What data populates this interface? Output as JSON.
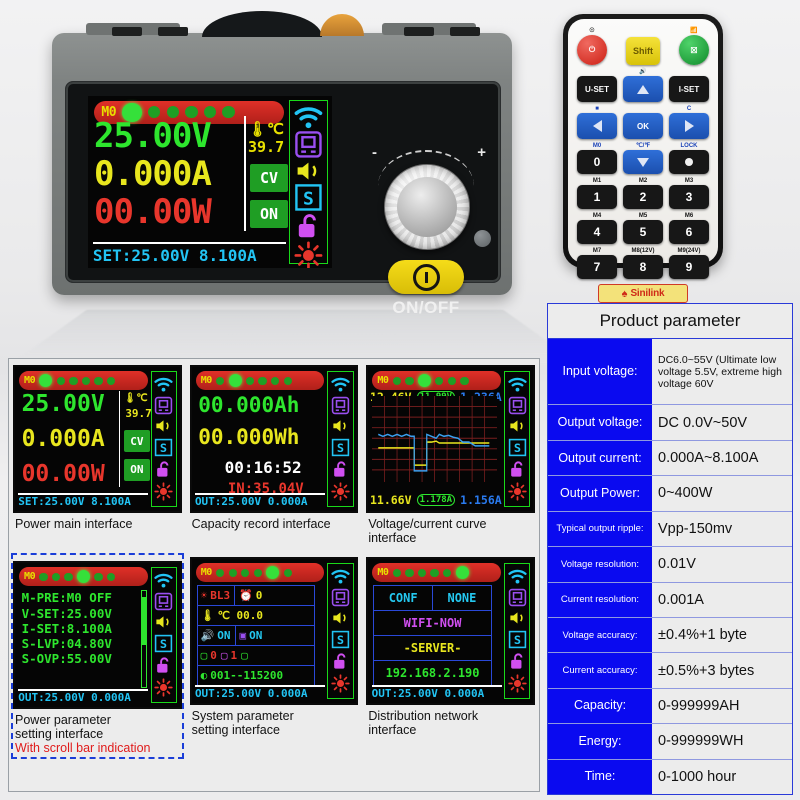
{
  "device": {
    "screen": {
      "memory_label": "M0",
      "voltage": "25.00V",
      "current": "0.000A",
      "power": "00.00W",
      "temp_unit": "℃",
      "temp_value": "39.7",
      "mode_badge": "CV",
      "output_badge": "ON",
      "setbar": "SET:25.00V 8.100A"
    },
    "controls": {
      "knob_minus": "-",
      "knob_plus": "+",
      "onoff_label": "ON/OFF"
    }
  },
  "remote": {
    "keys": {
      "power": "",
      "shift": "Shift",
      "wifi": "",
      "uset": "U-SET",
      "iset": "I-SET",
      "up": "",
      "ok": "OK",
      "left": "",
      "right": "",
      "down": "",
      "zero": "0",
      "one": "1",
      "two": "2",
      "three": "3",
      "four": "4",
      "five": "5",
      "six": "6",
      "seven": "7",
      "eight": "8",
      "nine": "9"
    },
    "captions": {
      "power_icon": "power-icon",
      "wifi_icon": "wifi-icon",
      "sound": "",
      "bright": "",
      "celsius": "C",
      "m0": "M0",
      "temp_mode": "℃/℉",
      "lock": "LOCK",
      "m1": "M1",
      "m2": "M2",
      "m3": "M3",
      "m4": "M4",
      "m5": "M5",
      "m6": "M6",
      "m7": "M7",
      "m8": "M8(12V)",
      "m9": "M9(24V)"
    },
    "brand": "Sinilink"
  },
  "screenshots": [
    {
      "id": "power-main",
      "caption": "Power main interface",
      "caption_note": "",
      "memory_label": "M0",
      "active_dot": 0,
      "voltage": "25.00V",
      "current": "0.000A",
      "power": "00.00W",
      "temp_unit": "℃",
      "temp_value": "39.7",
      "mode_badge": "CV",
      "output_badge": "ON",
      "setbar": "SET:25.00V 8.100A"
    },
    {
      "id": "capacity-record",
      "caption": "Capacity record interface",
      "caption_note": "",
      "memory_label": "M0",
      "active_dot": 1,
      "amp_hours": "00.000Ah",
      "watt_hours": "00.000Wh",
      "timer": "00:16:52",
      "input_label": "IN:35.04V",
      "setbar": "OUT:25.00V 0.000A"
    },
    {
      "id": "voltage-current-curve",
      "caption": "Voltage/current curve interface",
      "caption_note": "",
      "memory_label": "M0",
      "active_dot": 3,
      "top_voltage": "12.46V",
      "top_boxed": "11.99V",
      "top_current": "1.236A",
      "bottom_voltage": "11.66V",
      "bottom_boxed": "1.178A",
      "bottom_current": "1.156A"
    },
    {
      "id": "power-parameter-setting",
      "caption": "Power parameter\nsetting interface",
      "caption_note": "With scroll bar indication",
      "memory_label": "M0",
      "active_dot": 4,
      "rows": [
        "M-PRE:M0 OFF",
        "V-SET:25.00V",
        "I-SET:8.100A",
        "S-LVP:04.80V",
        "S-OVP:55.00V"
      ],
      "setbar": "OUT:25.00V 0.000A"
    },
    {
      "id": "system-parameter-setting",
      "caption": "System parameter\nsetting interface",
      "caption_note": "",
      "memory_label": "M0",
      "active_dot": 5,
      "backlight": "BL3",
      "timer_value": "0",
      "temperature": "℃ 00.0",
      "sound_state": "ON",
      "device_state": "ON",
      "mem_a": "0",
      "mem_b": "1",
      "comm": "001--115200",
      "setbar": "OUT:25.00V 0.000A"
    },
    {
      "id": "distribution-network",
      "caption": "Distribution network\ninterface",
      "caption_note": "",
      "memory_label": "M0",
      "active_dot": 6,
      "conf_label": "CONF",
      "conf_value": "NONE",
      "wifi_name": "WIFI-NOW",
      "server_label": "-SERVER-",
      "ip_address": "192.168.2.190",
      "setbar": "OUT:25.00V 0.000A"
    }
  ],
  "parameter_table": {
    "title": "Product parameter",
    "rows": [
      {
        "key": "Input voltage:",
        "value": "DC6.0~55V (Ultimate low voltage 5.5V, extreme high voltage 60V"
      },
      {
        "key": "Output voltage:",
        "value": "DC 0.0V~50V"
      },
      {
        "key": "Output current:",
        "value": "0.000A~8.100A"
      },
      {
        "key": "Output Power:",
        "value": "0~400W"
      },
      {
        "key": "Typical output ripple:",
        "value": "Vpp-150mv"
      },
      {
        "key": "Voltage resolution:",
        "value": "0.01V"
      },
      {
        "key": "Current resolution:",
        "value": "0.001A"
      },
      {
        "key": "Voltage accuracy:",
        "value": "±0.4%+1 byte"
      },
      {
        "key": "Current accuracy:",
        "value": "±0.5%+3 bytes"
      },
      {
        "key": "Capacity:",
        "value": "0-999999AH"
      },
      {
        "key": "Energy:",
        "value": "0-999999WH"
      },
      {
        "key": "Time:",
        "value": "0-1000 hour"
      }
    ]
  },
  "chart_data": {
    "type": "line",
    "title": "Voltage/current curve",
    "series": [
      {
        "name": "voltage",
        "color": "#e8e61e",
        "values": [
          40,
          40,
          40,
          40,
          40,
          40,
          40,
          40,
          40,
          40,
          18,
          18,
          18,
          18,
          18,
          18,
          28,
          28,
          30,
          28,
          28,
          28,
          28,
          28,
          28,
          28,
          28,
          28,
          28,
          28,
          28,
          28
        ]
      },
      {
        "name": "current",
        "color": "#3aa0f0",
        "values": [
          58,
          56,
          58,
          56,
          58,
          56,
          58,
          56,
          58,
          56,
          92,
          92,
          92,
          92,
          95,
          92,
          56,
          58,
          54,
          58,
          56,
          60,
          58,
          62,
          62,
          70,
          70,
          72,
          72,
          72,
          72,
          72
        ]
      }
    ],
    "ylim": [
      0,
      100
    ],
    "grid": true
  }
}
